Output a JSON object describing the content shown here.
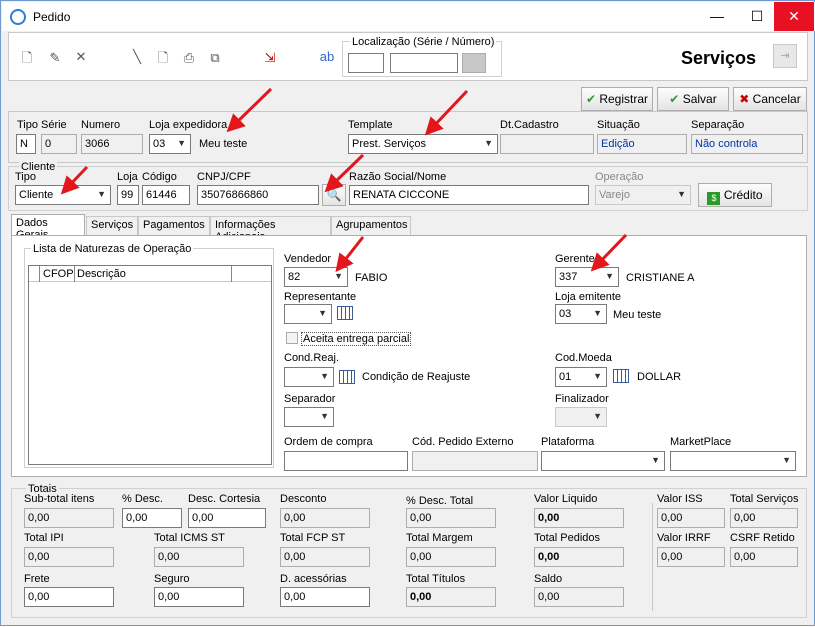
{
  "window": {
    "title": "Pedido",
    "minimize": "—",
    "maximize": "☐",
    "close": "✕"
  },
  "header": {
    "localizacao_label": "Localização (Série / Número)",
    "page_title": "Serviços",
    "buttons": {
      "registrar": "Registrar",
      "salvar": "Salvar",
      "cancelar": "Cancelar"
    }
  },
  "pedido": {
    "tipo_label": "Tipo",
    "tipo_value": "N",
    "serie_label": "Série",
    "serie_value": "0",
    "numero_label": "Numero",
    "numero_value": "3066",
    "loja_exp_label": "Loja expedidora",
    "loja_exp_value": "03",
    "loja_exp_name": "Meu teste",
    "template_label": "Template",
    "template_value": "Prest. Serviços",
    "dtcadastro_label": "Dt.Cadastro",
    "dtcadastro_value": "",
    "situacao_label": "Situação",
    "situacao_value": "Edição",
    "separacao_label": "Separação",
    "separacao_value": "Não controla"
  },
  "cliente": {
    "group_label": "Cliente",
    "tipo_label": "Tipo",
    "tipo_value": "Cliente",
    "loja_label": "Loja",
    "loja_value": "99",
    "codigo_label": "Código",
    "codigo_value": "61446",
    "cnpj_label": "CNPJ/CPF",
    "cnpj_value": "35076866860",
    "razao_label": "Razão Social/Nome",
    "razao_value": "RENATA CICCONE",
    "operacao_label": "Operação",
    "operacao_value": "Varejo",
    "credito_label": "Crédito"
  },
  "tabs": [
    "Dados Gerais",
    "Serviços",
    "Pagamentos",
    "Informações Adicionais",
    "Agrupamentos"
  ],
  "dados_gerais": {
    "naturezas_label": "Lista de Naturezas de Operação",
    "col_cfop": "CFOP",
    "col_descricao": "Descrição",
    "vendedor_label": "Vendedor",
    "vendedor_value": "82",
    "vendedor_name": "FABIO",
    "gerente_label": "Gerente",
    "gerente_value": "337",
    "gerente_name": "CRISTIANE A",
    "representante_label": "Representante",
    "representante_value": "",
    "loja_emitente_label": "Loja emitente",
    "loja_emitente_value": "03",
    "loja_emitente_name": "Meu teste",
    "aceita_label": "Aceita entrega parcial",
    "condreaj_label": "Cond.Reaj.",
    "condreaj_value": "",
    "condreaj_name": "Condição de Reajuste",
    "codmoeda_label": "Cod.Moeda",
    "codmoeda_value": "01",
    "codmoeda_name": "DOLLAR",
    "separador_label": "Separador",
    "finalizador_label": "Finalizador",
    "ordem_label": "Ordem de compra",
    "cod_externo_label": "Cód. Pedido Externo",
    "plataforma_label": "Plataforma",
    "marketplace_label": "MarketPlace"
  },
  "totais": {
    "group_label": "Totais",
    "subtotal_label": "Sub-total itens",
    "subtotal": "0,00",
    "pdesc_label": "% Desc.",
    "pdesc": "0,00",
    "desccortesia_label": "Desc. Cortesia",
    "desccortesia": "0,00",
    "desconto_label": "Desconto",
    "desconto": "0,00",
    "pdesctotal_label": "% Desc. Total",
    "pdesctotal": "0,00",
    "valorliquido_label": "Valor Liquido",
    "valorliquido": "0,00",
    "valoriss_label": "Valor ISS",
    "valoriss": "0,00",
    "totalservicos_label": "Total Serviços",
    "totalservicos": "0,00",
    "totalipi_label": "Total IPI",
    "totalipi": "0,00",
    "totalicmsst_label": "Total ICMS ST",
    "totalicmsst": "0,00",
    "totalfcpst_label": "Total FCP ST",
    "totalfcpst": "0,00",
    "totalmargem_label": "Total Margem",
    "totalmargem": "0,00",
    "totalpedidos_label": "Total Pedidos",
    "totalpedidos": "0,00",
    "valorirrf_label": "Valor IRRF",
    "valorirrf": "0,00",
    "csrf_label": "CSRF Retido",
    "csrf": "0,00",
    "frete_label": "Frete",
    "frete": "0,00",
    "seguro_label": "Seguro",
    "seguro": "0,00",
    "dacess_label": "D. acessórias",
    "dacess": "0,00",
    "totaltitulos_label": "Total Títulos",
    "totaltitulos": "0,00",
    "saldo_label": "Saldo",
    "saldo": "0,00"
  },
  "colors": {
    "accent_arrow": "#e3161b",
    "border": "#7a7a7a",
    "panel": "#f0f0f0"
  }
}
